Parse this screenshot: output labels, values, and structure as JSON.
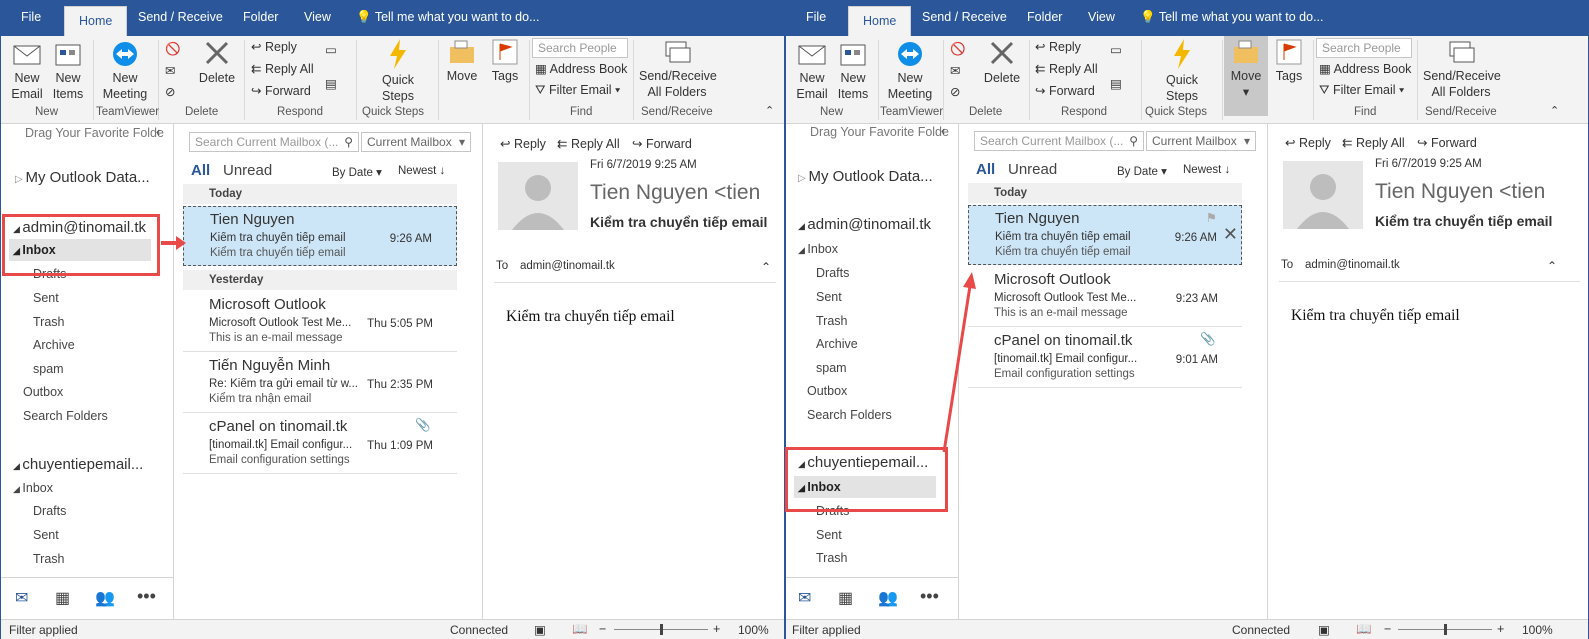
{
  "tabs": [
    "File",
    "Home",
    "Send / Receive",
    "Folder",
    "View"
  ],
  "tell_me": "Tell me what you want to do...",
  "ribbon": {
    "new_email": "New\nEmail",
    "new_items": "New\nItems",
    "new_meeting": "New\nMeeting",
    "delete": "Delete",
    "reply": "Reply",
    "reply_all": "Reply All",
    "forward": "Forward",
    "quick_steps": "Quick\nSteps",
    "move": "Move",
    "tags": "Tags",
    "search_people": "Search People",
    "address_book": "Address Book",
    "filter_email": "Filter Email",
    "send_receive_all": "Send/Receive\nAll Folders",
    "groups": [
      "New",
      "TeamViewer",
      "Delete",
      "Respond",
      "Quick Steps",
      "Find",
      "Send/Receive"
    ]
  },
  "nav": {
    "drag_hint": "Drag Your Favorite Folde",
    "data_file": "My Outlook Data...",
    "account1": "admin@tinomail.tk",
    "account2": "chuyentiepemail...",
    "inbox": "Inbox",
    "folders": [
      "Drafts",
      "Sent",
      "Trash",
      "Archive",
      "spam"
    ],
    "outbox": "Outbox",
    "search_folders": "Search Folders"
  },
  "list": {
    "search_placeholder": "Search Current Mailbox (...",
    "scope": "Current Mailbox",
    "all": "All",
    "unread": "Unread",
    "by_date": "By Date",
    "newest": "Newest",
    "today": "Today",
    "yesterday": "Yesterday"
  },
  "win1_msgs": [
    {
      "from": "Tien Nguyen",
      "subject": "Kiểm tra chuyển tiếp email",
      "preview": "Kiểm tra chuyển tiếp email",
      "time": "9:26 AM"
    },
    {
      "from": "Microsoft Outlook",
      "subject": "Microsoft Outlook Test Me...",
      "preview": "This is an e-mail message",
      "time": "Thu 5:05 PM"
    },
    {
      "from": "Tiến Nguyễn Minh",
      "subject": "Re: Kiểm tra gửi email từ w...",
      "preview": "Kiểm tra nhận email",
      "time": "Thu 2:35 PM"
    },
    {
      "from": "cPanel on tinomail.tk",
      "subject": "[tinomail.tk] Email configur...",
      "preview": "Email configuration settings",
      "time": "Thu 1:09 PM"
    }
  ],
  "win2_msgs": [
    {
      "from": "Tien Nguyen",
      "subject": "Kiểm tra chuyển tiếp email",
      "preview": "Kiểm tra chuyển tiếp email",
      "time": "9:26 AM"
    },
    {
      "from": "Microsoft Outlook",
      "subject": "Microsoft Outlook Test Me...",
      "preview": "This is an e-mail message",
      "time": "9:23 AM"
    },
    {
      "from": "cPanel on tinomail.tk",
      "subject": "[tinomail.tk] Email configur...",
      "preview": "Email configuration settings",
      "time": "9:01 AM"
    }
  ],
  "reading": {
    "reply": "Reply",
    "reply_all": "Reply All",
    "forward": "Forward",
    "date": "Fri 6/7/2019 9:25 AM",
    "sender": "Tien Nguyen <tien",
    "subject": "Kiểm tra chuyển tiếp email",
    "to_label": "To",
    "to": "admin@tinomail.tk",
    "body": "Kiểm tra chuyển tiếp email"
  },
  "status": {
    "filter": "Filter applied",
    "connected": "Connected",
    "zoom": "100%"
  },
  "colors": {
    "accent": "#2b579a",
    "selection": "#cde6f7",
    "annotation": "#e84a4a"
  }
}
